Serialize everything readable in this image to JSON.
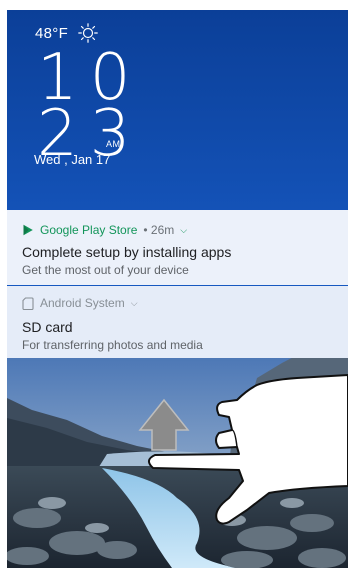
{
  "lockscreen": {
    "temperature": "48°F",
    "weather_icon": "sun-icon",
    "hour": "10",
    "minute": "23",
    "ampm": "AM",
    "date": "Wed , Jan 17"
  },
  "notifications": [
    {
      "app": "Google Play Store",
      "meta": "• 26m",
      "title": "Complete setup by installing apps",
      "body": "Get the most out of your device",
      "accent": "#13955a",
      "icon": "play-store-icon"
    },
    {
      "app": "Android System",
      "meta": "",
      "title": "SD card",
      "body": "For transferring photos and media",
      "accent": "#888f96",
      "icon": "sd-card-icon"
    }
  ],
  "gesture": {
    "hint": "swipe-up",
    "icons": [
      "arrow-up-icon",
      "hand-icon"
    ]
  }
}
